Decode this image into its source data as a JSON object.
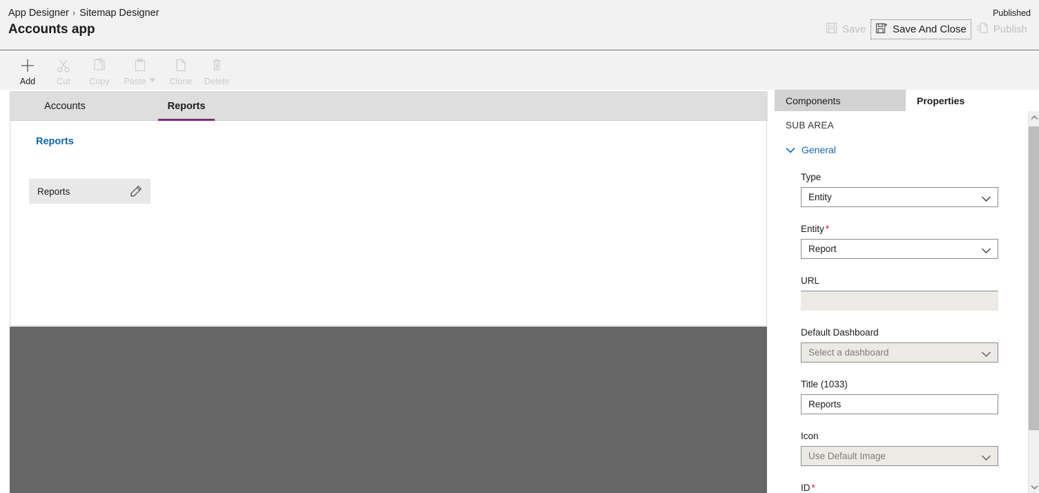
{
  "header": {
    "breadcrumb": {
      "parent": "App Designer",
      "separator": "›",
      "current": "Sitemap Designer"
    },
    "app_title": "Accounts app",
    "published_status": "Published",
    "actions": [
      {
        "label": "Save",
        "icon": "save-icon",
        "enabled": false,
        "focused": false
      },
      {
        "label": "Save And Close",
        "icon": "save-and-close-icon",
        "enabled": false,
        "focused": true
      },
      {
        "label": "Publish",
        "icon": "publish-icon",
        "enabled": false,
        "focused": false
      }
    ]
  },
  "toolbar": {
    "items": [
      {
        "label": "Add",
        "icon": "plus-icon",
        "enabled": true,
        "has_caret": false
      },
      {
        "label": "Cut",
        "icon": "scissors-icon",
        "enabled": false,
        "has_caret": false
      },
      {
        "label": "Copy",
        "icon": "copy-icon",
        "enabled": false,
        "has_caret": false
      },
      {
        "label": "Paste",
        "icon": "clipboard-icon",
        "enabled": false,
        "has_caret": true
      },
      {
        "label": "Clone",
        "icon": "clone-icon",
        "enabled": false,
        "has_caret": false
      },
      {
        "label": "Delete",
        "icon": "trash-icon",
        "enabled": false,
        "has_caret": false
      }
    ]
  },
  "canvas": {
    "tabs": [
      {
        "label": "Accounts",
        "active": false
      },
      {
        "label": "Reports",
        "active": true
      }
    ],
    "active_tab_accent": "#7b2d7b",
    "group": {
      "title": "Reports",
      "title_color": "#1266b5",
      "subareas": [
        {
          "label": "Reports",
          "edit_icon": "pencil-icon"
        }
      ]
    }
  },
  "right_panel": {
    "tabs": [
      {
        "label": "Components",
        "active": false
      },
      {
        "label": "Properties",
        "active": true
      }
    ],
    "caption": "SUB AREA",
    "section": {
      "label": "General",
      "expanded": true,
      "chevron": "chevron-down-icon"
    },
    "fields": [
      {
        "label": "Type",
        "required": false,
        "control": "dropdown",
        "value": "Entity",
        "placeholder": "",
        "state": "enabled"
      },
      {
        "label": "Entity",
        "required": true,
        "control": "dropdown",
        "value": "Report",
        "placeholder": "",
        "state": "enabled"
      },
      {
        "label": "URL",
        "required": false,
        "control": "text",
        "value": "",
        "placeholder": "",
        "state": "disabled"
      },
      {
        "label": "Default Dashboard",
        "required": false,
        "control": "dropdown",
        "value": "",
        "placeholder": "Select a dashboard",
        "state": "muted"
      },
      {
        "label": "Title (1033)",
        "required": false,
        "control": "text",
        "value": "Reports",
        "placeholder": "",
        "state": "enabled"
      },
      {
        "label": "Icon",
        "required": false,
        "control": "dropdown",
        "value": "",
        "placeholder": "Use Default Image",
        "state": "muted"
      },
      {
        "label": "ID",
        "required": true,
        "control": "text",
        "value": "",
        "placeholder": "",
        "state": "enabled"
      }
    ],
    "scrollbar": {
      "up_icon": "chevron-up-icon",
      "down_icon": "chevron-down-icon"
    }
  }
}
